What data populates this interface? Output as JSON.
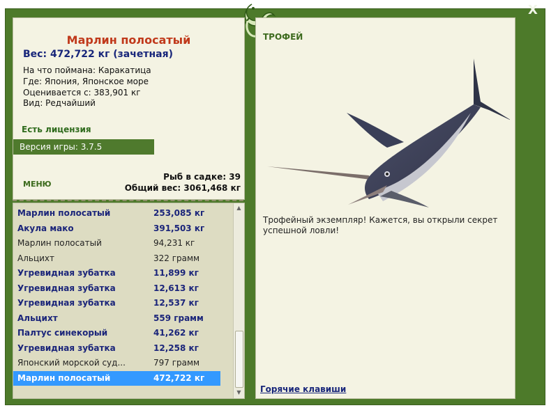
{
  "close_label": "X",
  "fish": {
    "name": "Марлин полосатый",
    "weight": "Вес: 472,722 кг (зачетная)",
    "caught_with": "На что поймана: Каракатица",
    "location": "Где: Япония, Японское море",
    "valued_from": "Оценивается с: 383,901 кг",
    "species": "Вид: Редчайший"
  },
  "license_text": "Есть лицензия",
  "version_text": "Версия игры: 3.7.5",
  "menu_label": "МЕНЮ",
  "keep": {
    "count_text": "Рыб в садке: 39",
    "total_text": "Общий вес: 3061,468 кг"
  },
  "catch_list": [
    {
      "name": "Марлин полосатый",
      "weight": "253,085 кг",
      "style": "bold"
    },
    {
      "name": "Акула мако",
      "weight": "391,503 кг",
      "style": "bold"
    },
    {
      "name": "Марлин полосатый",
      "weight": "94,231 кг",
      "style": "normal"
    },
    {
      "name": "Альцихт",
      "weight": "322 грамм",
      "style": "normal"
    },
    {
      "name": "Угревидная зубатка",
      "weight": "11,899 кг",
      "style": "bold"
    },
    {
      "name": "Угревидная зубатка",
      "weight": "12,613 кг",
      "style": "bold"
    },
    {
      "name": "Угревидная зубатка",
      "weight": "12,537 кг",
      "style": "bold"
    },
    {
      "name": "Альцихт",
      "weight": "559 грамм",
      "style": "bold"
    },
    {
      "name": "Палтус синекорый",
      "weight": "41,262 кг",
      "style": "bold"
    },
    {
      "name": "Угревидная зубатка",
      "weight": "12,258 кг",
      "style": "bold"
    },
    {
      "name": "Японский морской суд...",
      "weight": "797 грамм",
      "style": "normal"
    },
    {
      "name": "Марлин полосатый",
      "weight": "472,722 кг",
      "style": "selected"
    }
  ],
  "trophy": {
    "title": "ТРОФЕЙ",
    "text": "Трофейный экземпляр! Кажется, вы открыли секрет успешной ловли!"
  },
  "hotkeys_label": "Горячие клавиши",
  "colors": {
    "frame": "#4d7a2a",
    "panel": "#f4f3e3",
    "list_bg": "#dddcc2",
    "fish_title": "#c0391b",
    "dark_blue": "#18267a",
    "selection": "#3399ff"
  }
}
